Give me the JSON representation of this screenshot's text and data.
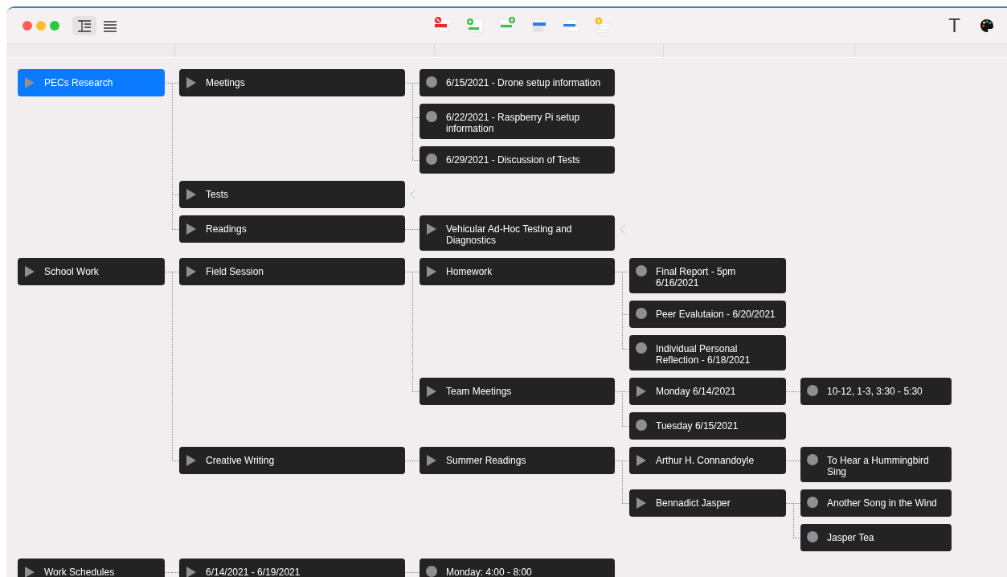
{
  "toolbar": {
    "window_buttons": [
      {
        "kind": "close"
      },
      {
        "kind": "minimize"
      },
      {
        "kind": "zoom"
      }
    ],
    "view_modes": [
      {
        "kind": "outline",
        "selected": true
      },
      {
        "kind": "list",
        "selected": false
      }
    ],
    "actions": [
      {
        "kind": "remove"
      },
      {
        "kind": "add_child"
      },
      {
        "kind": "add_sibling"
      },
      {
        "kind": "move_up"
      },
      {
        "kind": "move_down"
      },
      {
        "kind": "note"
      }
    ],
    "font_button": "T"
  },
  "tree": [
    {
      "text": "PECs Research",
      "kind": "group",
      "selected": true,
      "expanded": true,
      "children": [
        {
          "text": "Meetings",
          "kind": "group",
          "selected": false,
          "expanded": true,
          "children": [
            {
              "text": "6/15/2021 - Drone setup information",
              "kind": "leaf",
              "selected": false
            },
            {
              "text": "6/22/2021 - Raspberry Pi setup information",
              "kind": "leaf",
              "selected": false
            },
            {
              "text": "6/29/2021 - Discussion of Tests",
              "kind": "leaf",
              "selected": false
            }
          ]
        },
        {
          "text": "Tests",
          "kind": "group",
          "selected": false,
          "expanded": false
        },
        {
          "text": "Readings",
          "kind": "group",
          "selected": false,
          "expanded": true,
          "children": [
            {
              "text": "Vehicular Ad-Hoc Testing and Diagnostics",
              "kind": "group",
              "selected": false,
              "expanded": false
            }
          ]
        }
      ]
    },
    {
      "text": "School Work",
      "kind": "group",
      "selected": false,
      "expanded": true,
      "children": [
        {
          "text": "Field Session",
          "kind": "group",
          "selected": false,
          "expanded": true,
          "children": [
            {
              "text": "Homework",
              "kind": "group",
              "selected": false,
              "expanded": true,
              "children": [
                {
                  "text": "Final Report - 5pm 6/16/2021",
                  "kind": "leaf",
                  "selected": false
                },
                {
                  "text": "Peer Evalutaion - 6/20/2021",
                  "kind": "leaf",
                  "selected": false
                },
                {
                  "text": "Individual Personal Reflection - 6/18/2021",
                  "kind": "leaf",
                  "selected": false
                }
              ]
            },
            {
              "text": "Team Meetings",
              "kind": "group",
              "selected": false,
              "expanded": true,
              "children": [
                {
                  "text": "Monday 6/14/2021",
                  "kind": "group",
                  "selected": false,
                  "expanded": true,
                  "children": [
                    {
                      "text": "10-12, 1-3, 3:30 - 5:30",
                      "kind": "leaf",
                      "selected": false
                    }
                  ]
                },
                {
                  "text": "Tuesday 6/15/2021",
                  "kind": "leaf",
                  "selected": false
                }
              ]
            }
          ]
        },
        {
          "text": "Creative Writing",
          "kind": "group",
          "selected": false,
          "expanded": true,
          "children": [
            {
              "text": "Summer Readings",
              "kind": "group",
              "selected": false,
              "expanded": true,
              "children": [
                {
                  "text": "Arthur H. Connandoyle",
                  "kind": "group",
                  "selected": false,
                  "expanded": true,
                  "children": [
                    {
                      "text": "To Hear a Hummingbird Sing",
                      "kind": "leaf",
                      "selected": false
                    }
                  ]
                },
                {
                  "text": "Bennadict Jasper",
                  "kind": "group",
                  "selected": false,
                  "expanded": true,
                  "children": [
                    {
                      "text": "Another Song in the Wind",
                      "kind": "leaf",
                      "selected": false
                    },
                    {
                      "text": "Jasper Tea",
                      "kind": "leaf",
                      "selected": false
                    }
                  ]
                }
              ]
            }
          ]
        }
      ]
    },
    {
      "text": "Work Schedules",
      "kind": "group",
      "selected": false,
      "expanded": true,
      "children": [
        {
          "text": "6/14/2021 - 6/19/2021",
          "kind": "group",
          "selected": false,
          "expanded": true,
          "children": [
            {
              "text": "Monday: 4:00 - 8:00",
              "kind": "leaf",
              "selected": false
            }
          ]
        }
      ]
    }
  ]
}
